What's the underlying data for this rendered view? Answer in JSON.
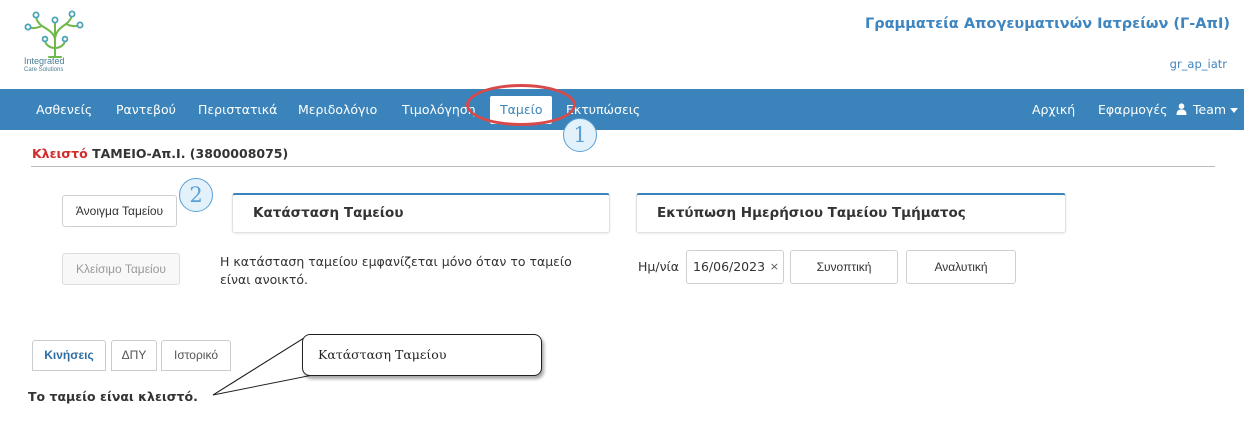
{
  "header": {
    "logo_text_line1": "Integrated",
    "logo_text_line2": "Care Solutions",
    "org_title": "Γραμματεία Απογευματινών Ιατρείων (Γ-ΑπΙ)",
    "username": "gr_ap_iatr"
  },
  "nav": {
    "left_items": [
      "Ασθενείς",
      "Ραντεβού",
      "Περιστατικά",
      "Μεριδολόγιο",
      "Τιμολόγηση",
      "Ταμείο",
      "Εκτυπώσεις"
    ],
    "active_item": "Ταμείο",
    "right_items": [
      "Αρχική",
      "Εφαρμογές"
    ],
    "user_menu": "Team"
  },
  "annotations": {
    "step1": "1",
    "step2": "2",
    "callout_text": "Κατάσταση Ταμείου"
  },
  "status": {
    "state": "Κλειστό",
    "cashier_label": "ΤΑΜΕΙΟ-Απ.Ι. (3800008075)"
  },
  "actions": {
    "open_button": "Άνοιγμα Ταμείου",
    "close_button": "Κλείσιμο Ταμείου"
  },
  "cash_status_panel": {
    "title": "Κατάσταση Ταμείου",
    "message": "Η κατάσταση ταμείου εμφανίζεται μόνο όταν το ταμείο είναι ανοικτό."
  },
  "daily_print_panel": {
    "title": "Εκτύπωση Ημερήσιου Ταμείου Τμήματος",
    "date_label": "Ημ/νία",
    "date_value": "16/06/2023",
    "clear_symbol": "×",
    "summary_button": "Συνοπτική",
    "detailed_button": "Αναλυτική"
  },
  "tabs": [
    "Κινήσεις",
    "ΔΠΥ",
    "Ιστορικό"
  ],
  "active_tab": "Κινήσεις",
  "closed_message": "Το ταμείο είναι κλειστό.",
  "colors": {
    "navbar": "#3a84bb",
    "title_blue": "#3f86c1",
    "closed_red": "#d22b2b",
    "highlight_ellipse": "#d84a4a",
    "step_circle": "#5aa0d6"
  },
  "icons": {
    "user_menu_icon": "user-icon",
    "dropdown_icon": "caret-down-icon"
  }
}
